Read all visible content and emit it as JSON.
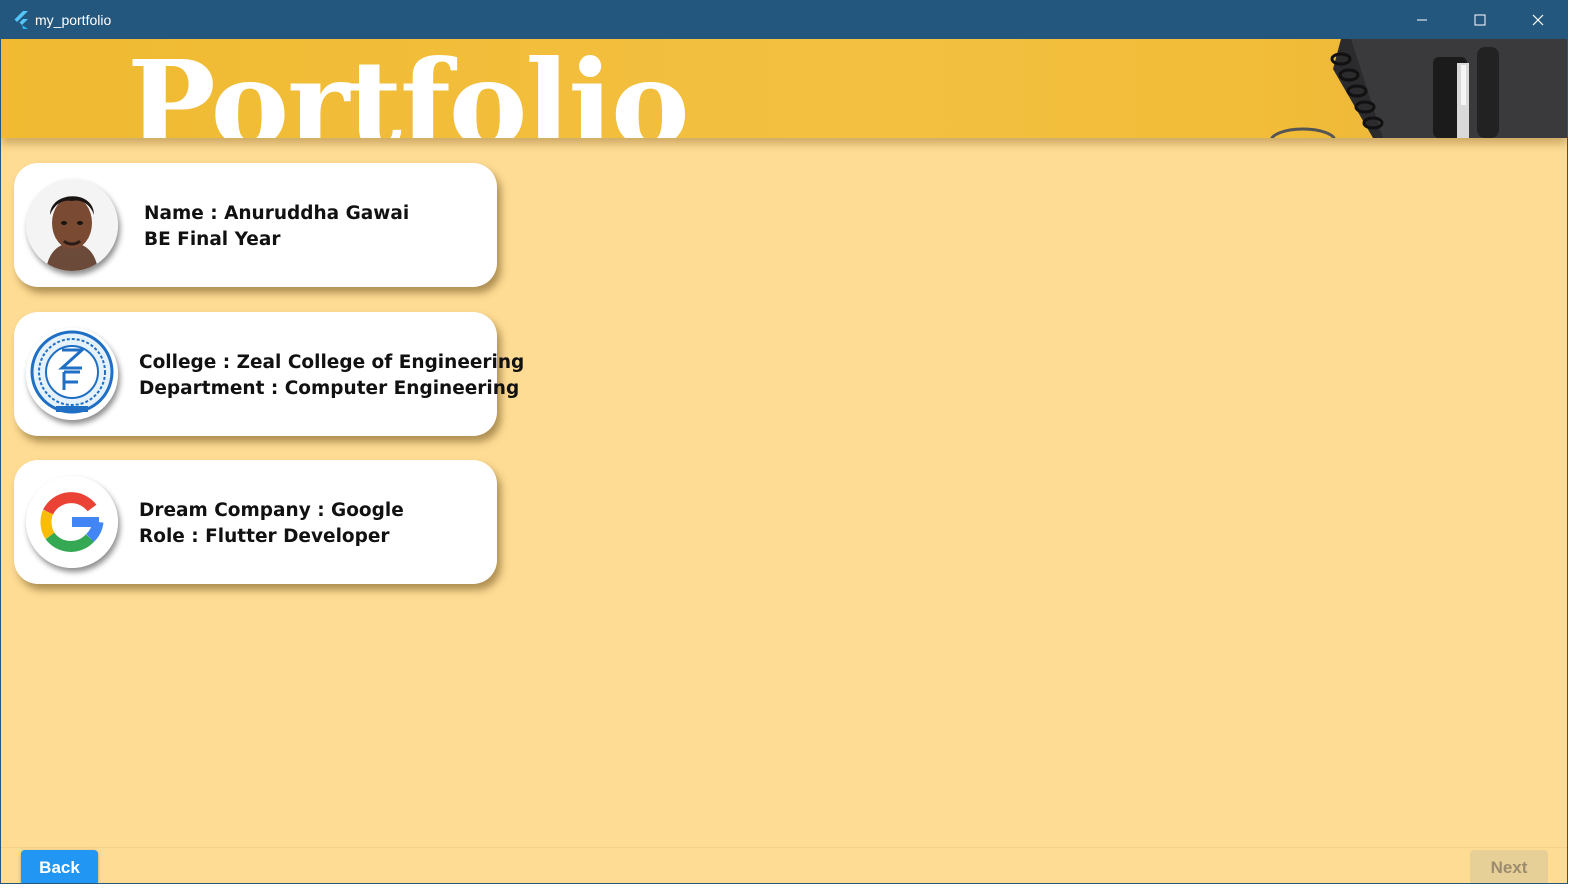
{
  "window": {
    "title": "my_portfolio",
    "controls": {
      "minimize_icon": "minimize-icon",
      "maximize_icon": "maximize-icon",
      "close_icon": "close-icon"
    }
  },
  "banner": {
    "title": "Portfolio",
    "background_color": "#f2bd38"
  },
  "cards": [
    {
      "avatar": "profile-photo",
      "line1": "Name : Anuruddha Gawai",
      "line2": "BE Final Year"
    },
    {
      "avatar": "college-logo",
      "line1": "College : Zeal College of Engineering",
      "line2": "Department : Computer Engineering"
    },
    {
      "avatar": "google-logo",
      "line1": "Dream Company : Google",
      "line2": "Role : Flutter Developer"
    }
  ],
  "navigation": {
    "back_label": "Back",
    "next_label": "Next",
    "next_enabled": false
  },
  "colors": {
    "titlebar": "#24577e",
    "page_background": "#fedc94",
    "card_background": "#ffffff",
    "back_button": "#2196f3",
    "next_button_disabled": "#e7cf98"
  }
}
